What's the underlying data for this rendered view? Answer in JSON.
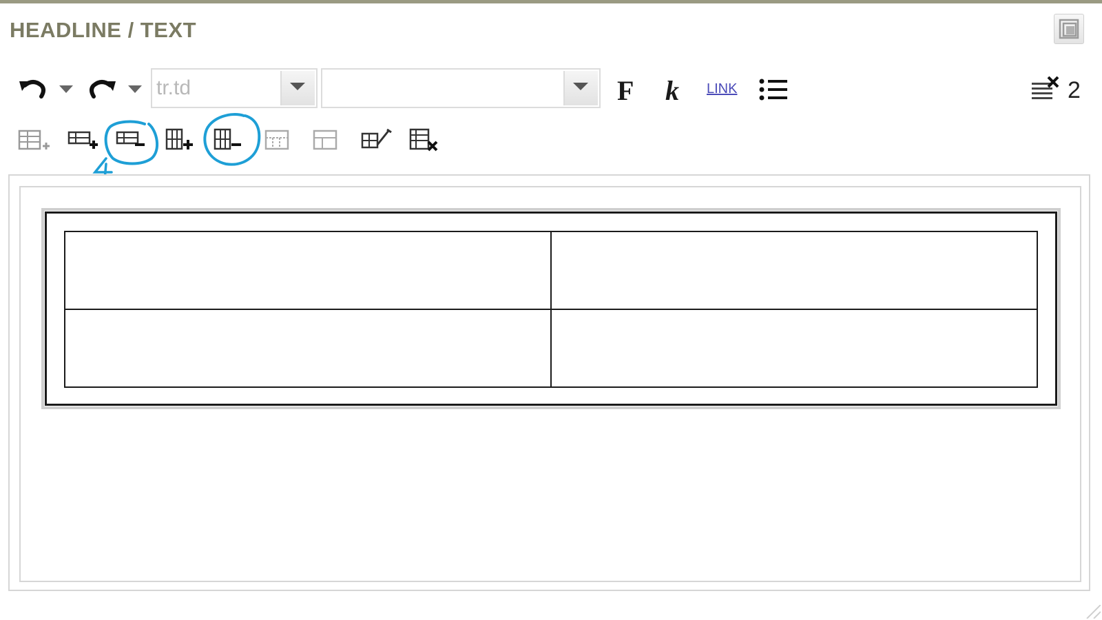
{
  "panel": {
    "title": "HEADLINE / TEXT"
  },
  "toolbar": {
    "row1": [
      {
        "name": "undo-icon"
      },
      {
        "name": "undo-dropdown-icon"
      },
      {
        "name": "redo-icon"
      },
      {
        "name": "redo-dropdown-icon"
      },
      {
        "name": "bold-icon",
        "label": "F"
      },
      {
        "name": "italic-icon",
        "label": "k"
      },
      {
        "name": "link-icon",
        "label": "LINK"
      },
      {
        "name": "bulleted-list-icon"
      }
    ],
    "element_path_select": {
      "value": "tr.td"
    },
    "format_select": {
      "value": ""
    },
    "clear_formatting_counter": "2",
    "row2": [
      {
        "name": "insert-table-icon"
      },
      {
        "name": "insert-row-icon"
      },
      {
        "name": "delete-row-icon"
      },
      {
        "name": "insert-column-icon"
      },
      {
        "name": "delete-column-icon"
      },
      {
        "name": "split-cells-icon"
      },
      {
        "name": "merge-cells-icon"
      },
      {
        "name": "table-properties-icon"
      },
      {
        "name": "delete-table-icon"
      }
    ]
  },
  "annotations": {
    "number_label": "4",
    "color": "#1e9fd6",
    "circled_icons": [
      "delete-row-icon",
      "delete-column-icon"
    ]
  },
  "editor": {
    "table": {
      "rows": [
        [
          "",
          ""
        ],
        [
          "",
          ""
        ]
      ]
    }
  },
  "colors": {
    "title": "#7b7b63",
    "top_border": "#9a9a82",
    "link": "#4a4ab8"
  }
}
